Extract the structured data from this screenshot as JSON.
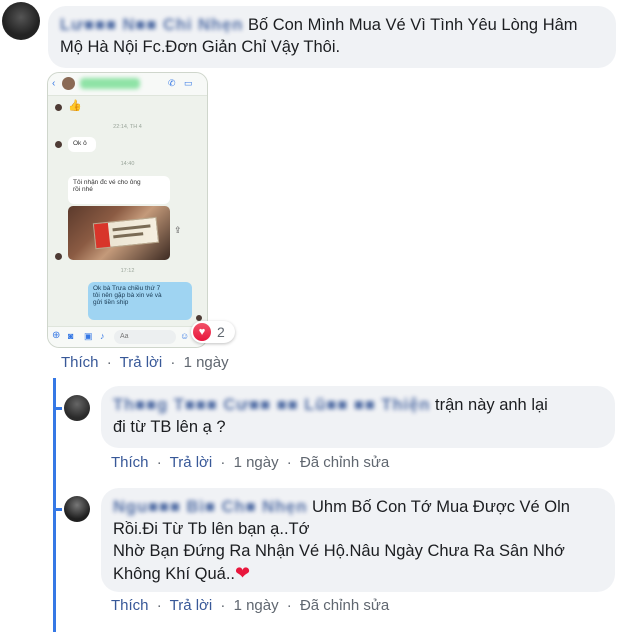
{
  "comments": [
    {
      "author": "Lư■■■ N■■ Chi Nhẹn",
      "text_line1": "Bố Con Mình Mua Vé Vì Tình Yêu Lòng Hâm",
      "text_line2": "Mộ Hà Nội Fc.Đơn Giản Chỉ Vậy Thôi.",
      "reaction_count": "2",
      "actions": {
        "like": "Thích",
        "reply": "Trả lời",
        "time": "1 ngày"
      }
    }
  ],
  "replies": [
    {
      "author": "Th■■g T■■■ Cư■■ ■■ Lũ■■ ■■ Thiện",
      "text_line1": "trận này anh lại",
      "text_line2": "đi từ TB lên ạ ?",
      "actions": {
        "like": "Thích",
        "reply": "Trả lời",
        "time": "1 ngày",
        "edited": "Đã chỉnh sửa"
      }
    },
    {
      "author": "Ngu■■■ Bì■ Ch■ Nhẹn",
      "text_line1": "Uhm Bố Con Tớ Mua Được Vé Oln",
      "text_line2": "Rồi.Đi Từ Tb lên bạn ạ..Tớ",
      "text_line3": "Nhờ Bạn Đứng Ra Nhận Vé Hộ.Nâu Ngày Chưa Ra Sân Nhớ",
      "text_line4": "Không Khí Quá..",
      "actions": {
        "like": "Thích",
        "reply": "Trả lời",
        "time": "1 ngày",
        "edited": "Đã chỉnh sửa"
      }
    }
  ],
  "phone_screenshot": {
    "time1": "22:14, TH 4",
    "msg1": "Ok ô",
    "time2": "14:40",
    "msg2_line1": "Tôi nhận đc vé cho ông",
    "msg2_line2": "rồi nhé",
    "time3": "17:12",
    "msg3_line1": "Ok bà Trưa chiều thứ 7",
    "msg3_line2": "tôi nên gặp bà xin vé và",
    "msg3_line3": "gửi tiền ship",
    "input_placeholder": "Aa"
  },
  "colors": {
    "link": "#385898",
    "bubble": "#f0f2f5",
    "thread": "#3578e5",
    "heart": "#e8163c"
  }
}
